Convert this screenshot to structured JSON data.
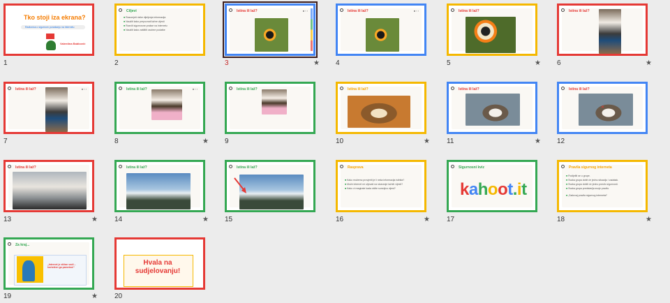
{
  "slides": [
    {
      "n": "1",
      "title": "Tko stoji iza ekrana?",
      "sub": "Radionica o sigurnom ponašanju na internetu",
      "author": "Valentina Babković",
      "star": false
    },
    {
      "n": "2",
      "title": "Ciljevi",
      "star": false
    },
    {
      "n": "3",
      "title": "Istina ili laž?",
      "star": true,
      "selected": true
    },
    {
      "n": "4",
      "title": "Istina ili laž?",
      "star": false
    },
    {
      "n": "5",
      "title": "Istina ili laž?",
      "star": true
    },
    {
      "n": "6",
      "title": "Istina ili laž?",
      "star": true
    },
    {
      "n": "7",
      "title": "Istina ili laž?",
      "star": false
    },
    {
      "n": "8",
      "title": "Istina ili laž?",
      "star": true
    },
    {
      "n": "9",
      "title": "Istina ili laž?",
      "star": false
    },
    {
      "n": "10",
      "title": "Istina ili laž?",
      "star": true
    },
    {
      "n": "11",
      "title": "Istina ili laž?",
      "star": true
    },
    {
      "n": "12",
      "title": "Istina ili laž?",
      "star": false
    },
    {
      "n": "13",
      "title": "Istina ili laž?",
      "star": true
    },
    {
      "n": "14",
      "title": "Istina ili laž?",
      "star": true
    },
    {
      "n": "15",
      "title": "Istina ili laž?",
      "star": false
    },
    {
      "n": "16",
      "title": "Rasprava",
      "star": true
    },
    {
      "n": "17",
      "title": "Sigurnosni kviz",
      "big": "kahoot.it",
      "star": false
    },
    {
      "n": "18",
      "title": "Pravila sigurnog interneta",
      "star": true
    },
    {
      "n": "19",
      "title": "Za kraj...",
      "quote": "„Internet je sličan vodi – korisšten ga pametno!“",
      "star": true
    },
    {
      "n": "20",
      "title": "Hvala na sudjelovanju!",
      "star": false
    }
  ],
  "star_glyph": "★"
}
